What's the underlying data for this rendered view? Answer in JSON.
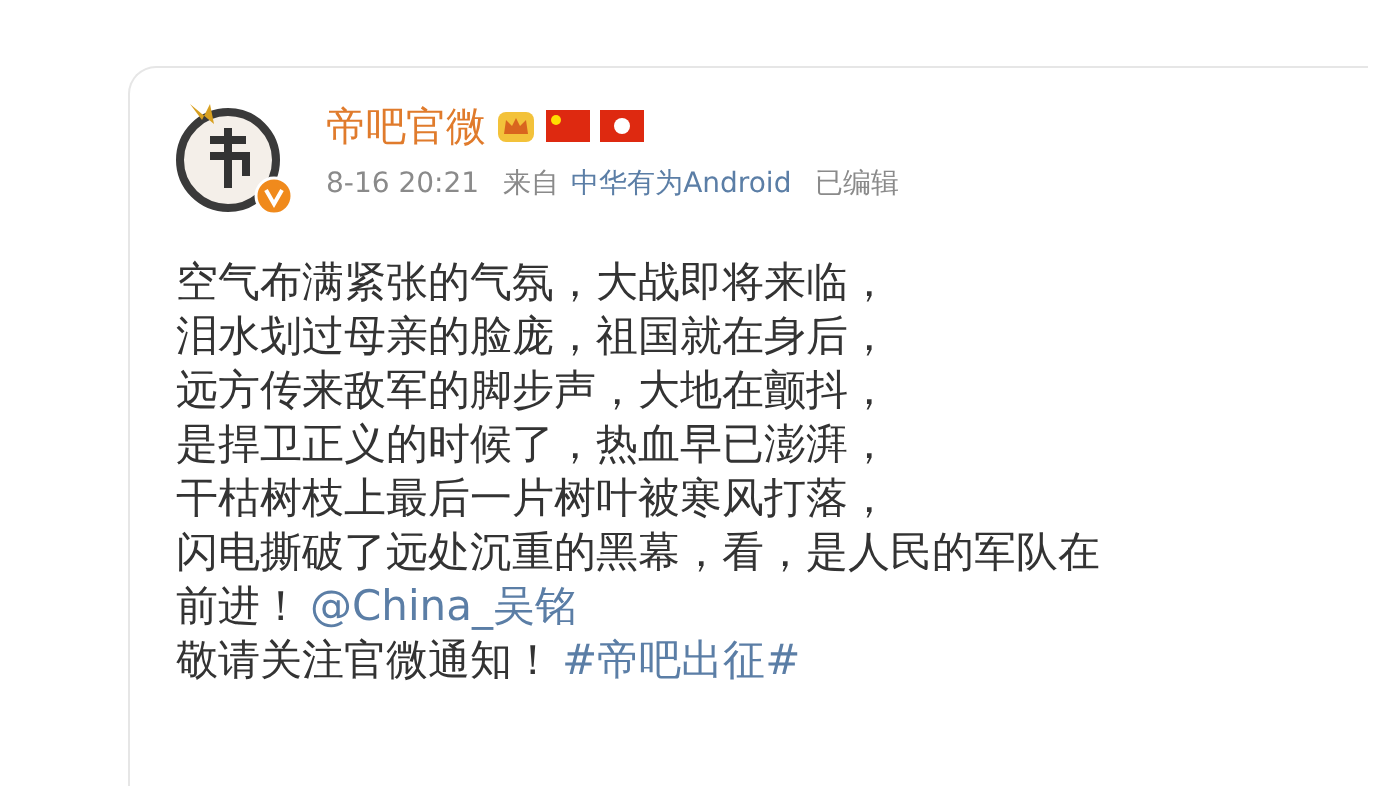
{
  "post": {
    "author": {
      "name": "帝吧官微",
      "verified": true
    },
    "meta": {
      "time": "8-16 20:21",
      "source_label": "来自",
      "source": "中华有为Android",
      "edited": "已编辑"
    },
    "lines": [
      [
        {
          "kind": "text",
          "text": "空气布满紧张的气氛，大战即将来临，"
        }
      ],
      [
        {
          "kind": "text",
          "text": "泪水划过母亲的脸庞，祖国就在身后，"
        }
      ],
      [
        {
          "kind": "text",
          "text": "远方传来敌军的脚步声，大地在颤抖，"
        }
      ],
      [
        {
          "kind": "text",
          "text": "是捍卫正义的时候了，热血早已澎湃，"
        }
      ],
      [
        {
          "kind": "text",
          "text": "干枯树枝上最后一片树叶被寒风打落，"
        }
      ],
      [
        {
          "kind": "text",
          "text": "闪电撕破了远处沉重的黑幕，看，是人民的军队在"
        }
      ],
      [
        {
          "kind": "text",
          "text": "前进！"
        },
        {
          "kind": "mention",
          "text": "@China_吴铭"
        }
      ],
      [
        {
          "kind": "text",
          "text": "敬请关注官微通知！"
        },
        {
          "kind": "hashtag",
          "text": "#帝吧出征#"
        }
      ]
    ]
  }
}
